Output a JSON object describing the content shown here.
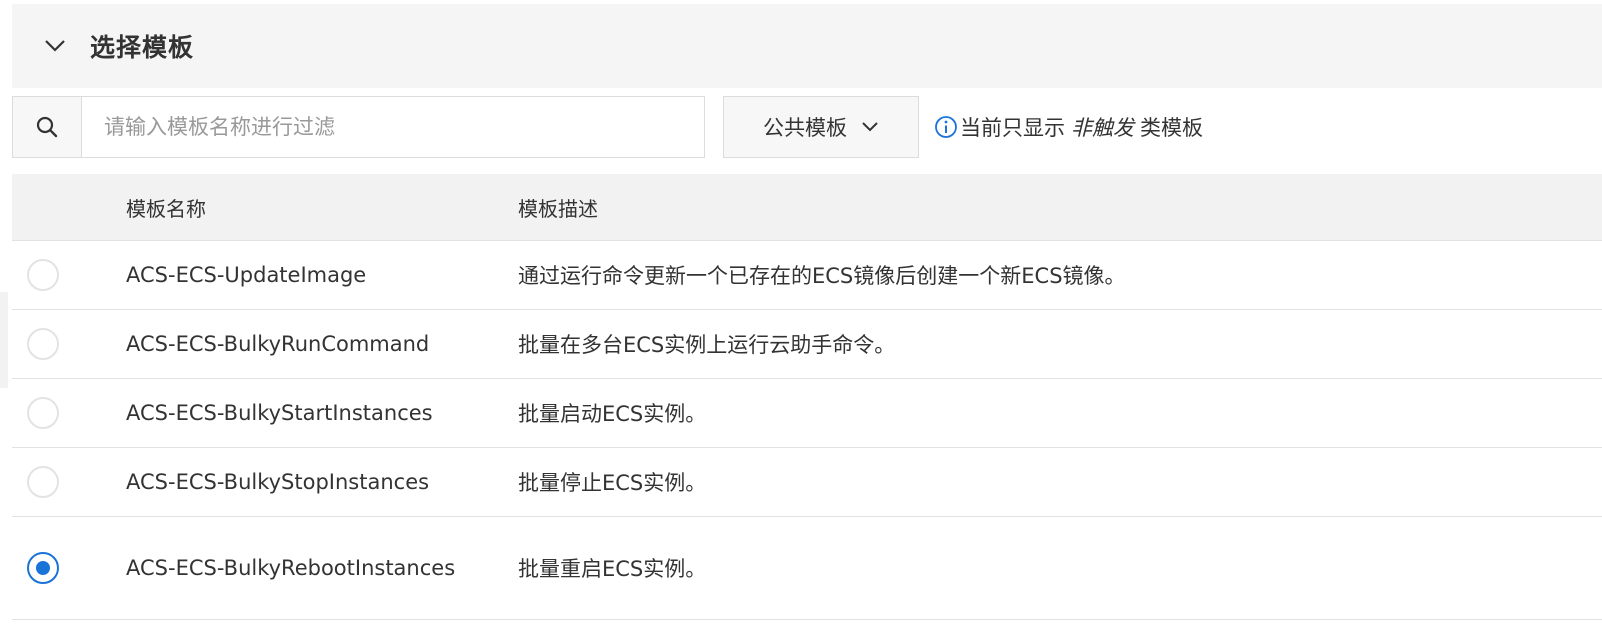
{
  "section": {
    "title": "选择模板",
    "toggle_icon": "chevron-down-icon"
  },
  "toolbar": {
    "search_icon": "search-icon",
    "search_placeholder": "请输入模板名称进行过滤",
    "search_value": "",
    "scope_selected": "公共模板",
    "scope_icon": "chevron-down-icon",
    "notice_prefix": "当前只显示",
    "notice_emphasis": "非触发",
    "notice_suffix": "类模板",
    "notice_icon": "info-icon"
  },
  "table": {
    "headers": {
      "name": "模板名称",
      "description": "模板描述"
    },
    "rows": [
      {
        "name": "ACS-ECS-UpdateImage",
        "description": "通过运行命令更新一个已存在的ECS镜像后创建一个新ECS镜像。",
        "selected": false
      },
      {
        "name": "ACS-ECS-BulkyRunCommand",
        "description": "批量在多台ECS实例上运行云助手命令。",
        "selected": false
      },
      {
        "name": "ACS-ECS-BulkyStartInstances",
        "description": "批量启动ECS实例。",
        "selected": false
      },
      {
        "name": "ACS-ECS-BulkyStopInstances",
        "description": "批量停止ECS实例。",
        "selected": false
      },
      {
        "name": "ACS-ECS-BulkyRebootInstances",
        "description": "批量重启ECS实例。",
        "selected": true
      }
    ]
  },
  "colors": {
    "accent": "#1a73d9",
    "header_bg": "#f5f5f5",
    "table_header_bg": "#f2f2f2",
    "border": "#dcdcdc"
  }
}
